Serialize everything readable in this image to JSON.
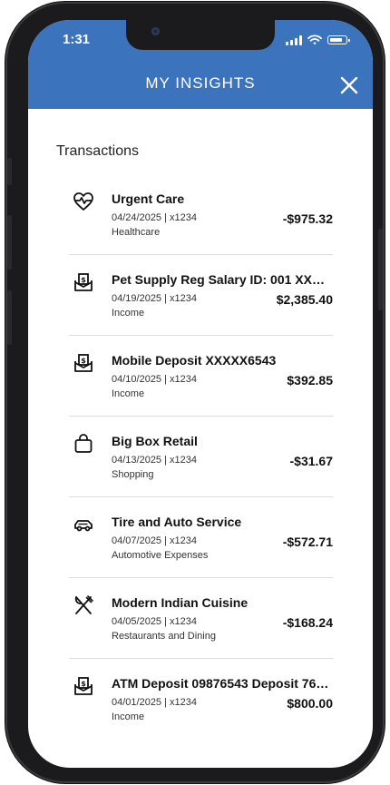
{
  "status_bar": {
    "time": "1:31"
  },
  "header": {
    "title": "MY INSIGHTS"
  },
  "section": {
    "title": "Transactions"
  },
  "transactions": [
    {
      "icon": "heartbeat-icon",
      "merchant": "Urgent Care",
      "date_account": "04/24/2025 | x1234",
      "category": "Healthcare",
      "amount": "-$975.32"
    },
    {
      "icon": "deposit-icon",
      "merchant": "Pet Supply Reg Salary ID: 001 XXXX...",
      "date_account": "04/19/2025 | x1234",
      "category": "Income",
      "amount": "$2,385.40"
    },
    {
      "icon": "deposit-icon",
      "merchant": "Mobile Deposit XXXXX6543",
      "date_account": "04/10/2025 | x1234",
      "category": "Income",
      "amount": "$392.85"
    },
    {
      "icon": "shopping-bag-icon",
      "merchant": "Big Box Retail",
      "date_account": "04/13/2025 | x1234",
      "category": "Shopping",
      "amount": "-$31.67"
    },
    {
      "icon": "car-icon",
      "merchant": "Tire and Auto Service",
      "date_account": "04/07/2025 | x1234",
      "category": "Automotive Expenses",
      "amount": "-$572.71"
    },
    {
      "icon": "fork-knife-icon",
      "merchant": "Modern Indian Cuisine",
      "date_account": "04/05/2025 | x1234",
      "category": "Restaurants and Dining",
      "amount": "-$168.24"
    },
    {
      "icon": "deposit-icon",
      "merchant": "ATM Deposit 09876543 Deposit 76231...",
      "date_account": "04/01/2025 | x1234",
      "category": "Income",
      "amount": "$800.00"
    }
  ],
  "colors": {
    "header": "#3c73bd",
    "text": "#111111",
    "divider": "#dcdcdc"
  }
}
